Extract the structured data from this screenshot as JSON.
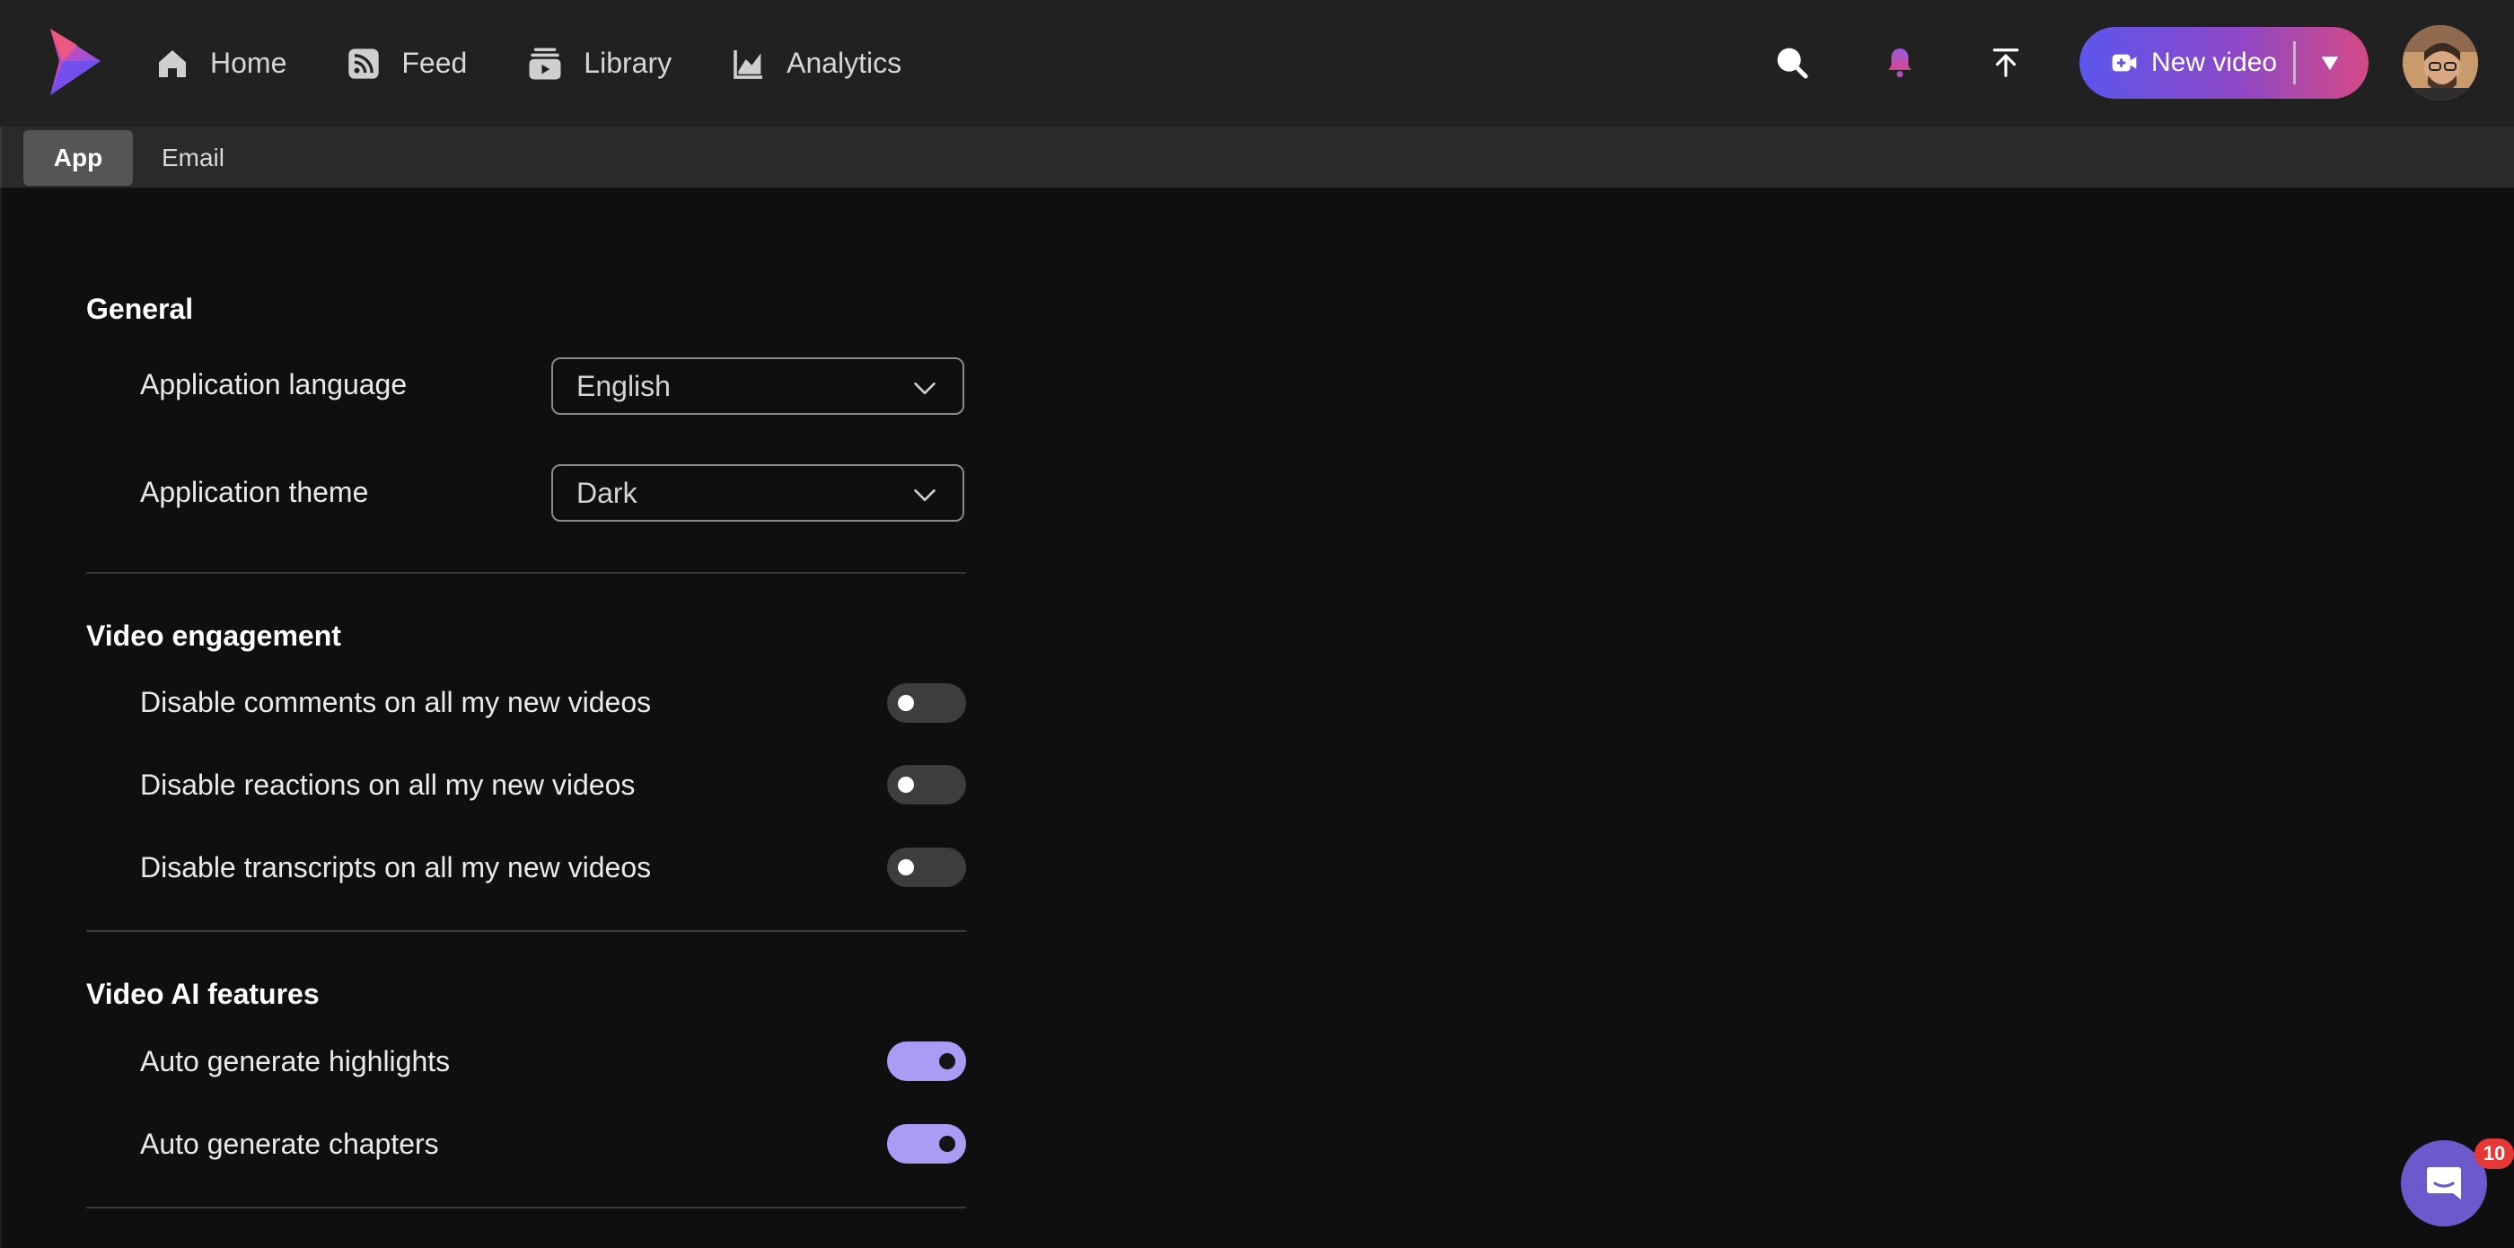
{
  "header": {
    "logo_icon": "play-logo-icon",
    "nav": [
      {
        "label": "Home",
        "icon": "home-icon"
      },
      {
        "label": "Feed",
        "icon": "rss-feed-icon"
      },
      {
        "label": "Library",
        "icon": "library-stack-icon"
      },
      {
        "label": "Analytics",
        "icon": "analytics-chart-icon"
      }
    ],
    "search_icon": "search-icon",
    "notifications_icon": "bell-icon",
    "upload_icon": "upload-icon",
    "new_video_label": "New video",
    "new_video_icon": "video-plus-icon",
    "new_video_caret_icon": "caret-down-icon",
    "gradient_colors": [
      "#5b56ee",
      "#8e48c6",
      "#d44a86"
    ]
  },
  "tabs": [
    {
      "label": "App",
      "active": true
    },
    {
      "label": "Email",
      "active": false
    }
  ],
  "general": {
    "title": "General",
    "language": {
      "label": "Application language",
      "value": "English"
    },
    "theme": {
      "label": "Application theme",
      "value": "Dark"
    }
  },
  "engagement": {
    "title": "Video engagement",
    "items": [
      {
        "label": "Disable comments on all my new videos",
        "on": false
      },
      {
        "label": "Disable reactions on all my new videos",
        "on": false
      },
      {
        "label": "Disable transcripts on all my new videos",
        "on": false
      }
    ]
  },
  "ai": {
    "title": "Video AI features",
    "items": [
      {
        "label": "Auto generate highlights",
        "on": true
      },
      {
        "label": "Auto generate chapters",
        "on": true
      }
    ]
  },
  "chat": {
    "icon": "chat-bubble-icon",
    "badge": "10"
  },
  "colors": {
    "toggle_on": "#a99cf5",
    "toggle_off": "#3d3d3d",
    "chat": "#6a5acd",
    "badge": "#e53935"
  }
}
